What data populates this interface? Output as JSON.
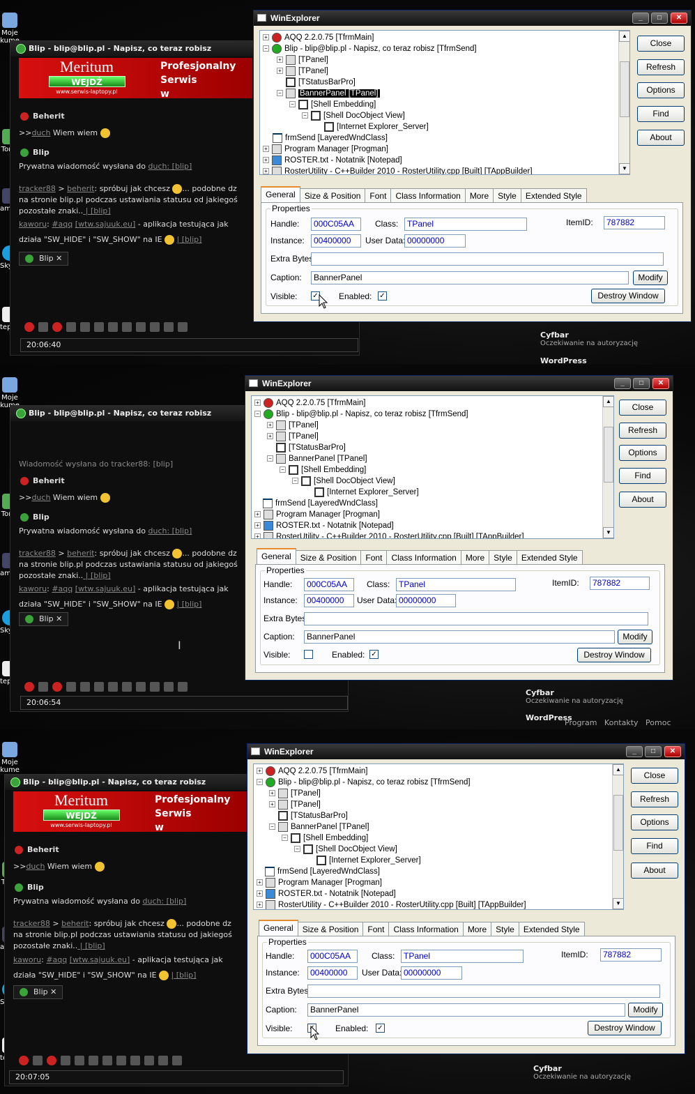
{
  "chat": {
    "title": "Blip - blip@blip.pl - Napisz, co teraz robisz",
    "banner": {
      "brand": "Meritum",
      "button": "WEJDŹ",
      "url": "www.serwis-laptopy.pl",
      "right_line1": "Profesjonalny",
      "right_line2": "Serwis",
      "right_line3": "w"
    },
    "hidden_line": "Wiadomość wysłana do tracker88: [blip]",
    "nick1": "Beherit",
    "msg1_prefix": ">>",
    "msg1_link": "duch",
    "msg1_text": "Wiem wiem",
    "nick2": "Blip",
    "msg2_text": "Prywatna wiadomość wysłana do",
    "msg2_link": "duch",
    "msg2_tail": ": [blip]",
    "msg3_link": "tracker88",
    "msg3_mid": " > ",
    "msg3_link2": "beherit",
    "msg3_text": ": spróbuj jak chcesz",
    "msg3_text2": "... podobne dz",
    "msg3_line2": "na stronie blip.pl podczas ustawiania statusu od jakiegoś",
    "msg3_line3": "pozostałe znaki..",
    "msg3_tail": " | [blip]",
    "msg4_link": "kaworu",
    "msg4_link2": "#aqq",
    "msg4_link3": "[wtw.sajuuk.eu]",
    "msg4_text": " - aplikacja testująca jak",
    "msg4_line2": "działa \"SW_HIDE\" i \"SW_SHOW\" na IE",
    "msg4_tail": "| [blip]",
    "tab": "Blip",
    "times": [
      "20:06:40",
      "20:06:54",
      "20:07:05"
    ]
  },
  "desktop": {
    "moje": "Moje",
    "kum": "kume",
    "torrent": "Torre",
    "teamspeak": "amSpeak",
    "skype": "Skype",
    "notepad": "tepad++"
  },
  "side": {
    "cyfbar": "Cyfbar",
    "cyf_status": "Oczekiwanie na autoryzację",
    "wordpress": "WordPress",
    "menu": [
      "Program",
      "Kontakty",
      "Pomoc"
    ]
  },
  "win": {
    "title": "WinExplorer",
    "tree": [
      {
        "t": "AQQ 2.2.0.75 [TfrmMain]"
      },
      {
        "t": "Blip - blip@blip.pl - Napisz, co teraz robisz [TfrmSend]"
      },
      {
        "t": "[TPanel]"
      },
      {
        "t": "[TPanel]"
      },
      {
        "t": "[TStatusBarPro]"
      },
      {
        "t": "BannerPanel [TPanel]"
      },
      {
        "t": "[Shell Embedding]"
      },
      {
        "t": "[Shell DocObject View]"
      },
      {
        "t": "[Internet Explorer_Server]"
      },
      {
        "t": "frmSend [LayeredWndClass]"
      },
      {
        "t": "Program Manager [Progman]"
      },
      {
        "t": "ROSTER.txt - Notatnik [Notepad]"
      },
      {
        "t": "RosterUtility - C++Builder 2010 - RosterUtility.cpp [Built] [TAppBuilder]"
      }
    ],
    "buttons": {
      "close": "Close",
      "refresh": "Refresh",
      "options": "Options",
      "find": "Find",
      "about": "About"
    },
    "tabs": [
      "General",
      "Size & Position",
      "Font",
      "Class Information",
      "More",
      "Style",
      "Extended Style"
    ],
    "props": {
      "group": "Properties",
      "handle_label": "Handle:",
      "handle": "000C05AA",
      "class_label": "Class:",
      "class": "TPanel",
      "itemid_label": "ItemID:",
      "itemid": "787882",
      "instance_label": "Instance:",
      "instance": "00400000",
      "userdata_label": "User Data:",
      "userdata": "00000000",
      "extra_label": "Extra Bytes:",
      "extra": "",
      "caption_label": "Caption:",
      "caption": "BannerPanel",
      "visible_label": "Visible:",
      "enabled_label": "Enabled:",
      "modify": "Modify",
      "destroy": "Destroy Window"
    },
    "check": "✓"
  }
}
